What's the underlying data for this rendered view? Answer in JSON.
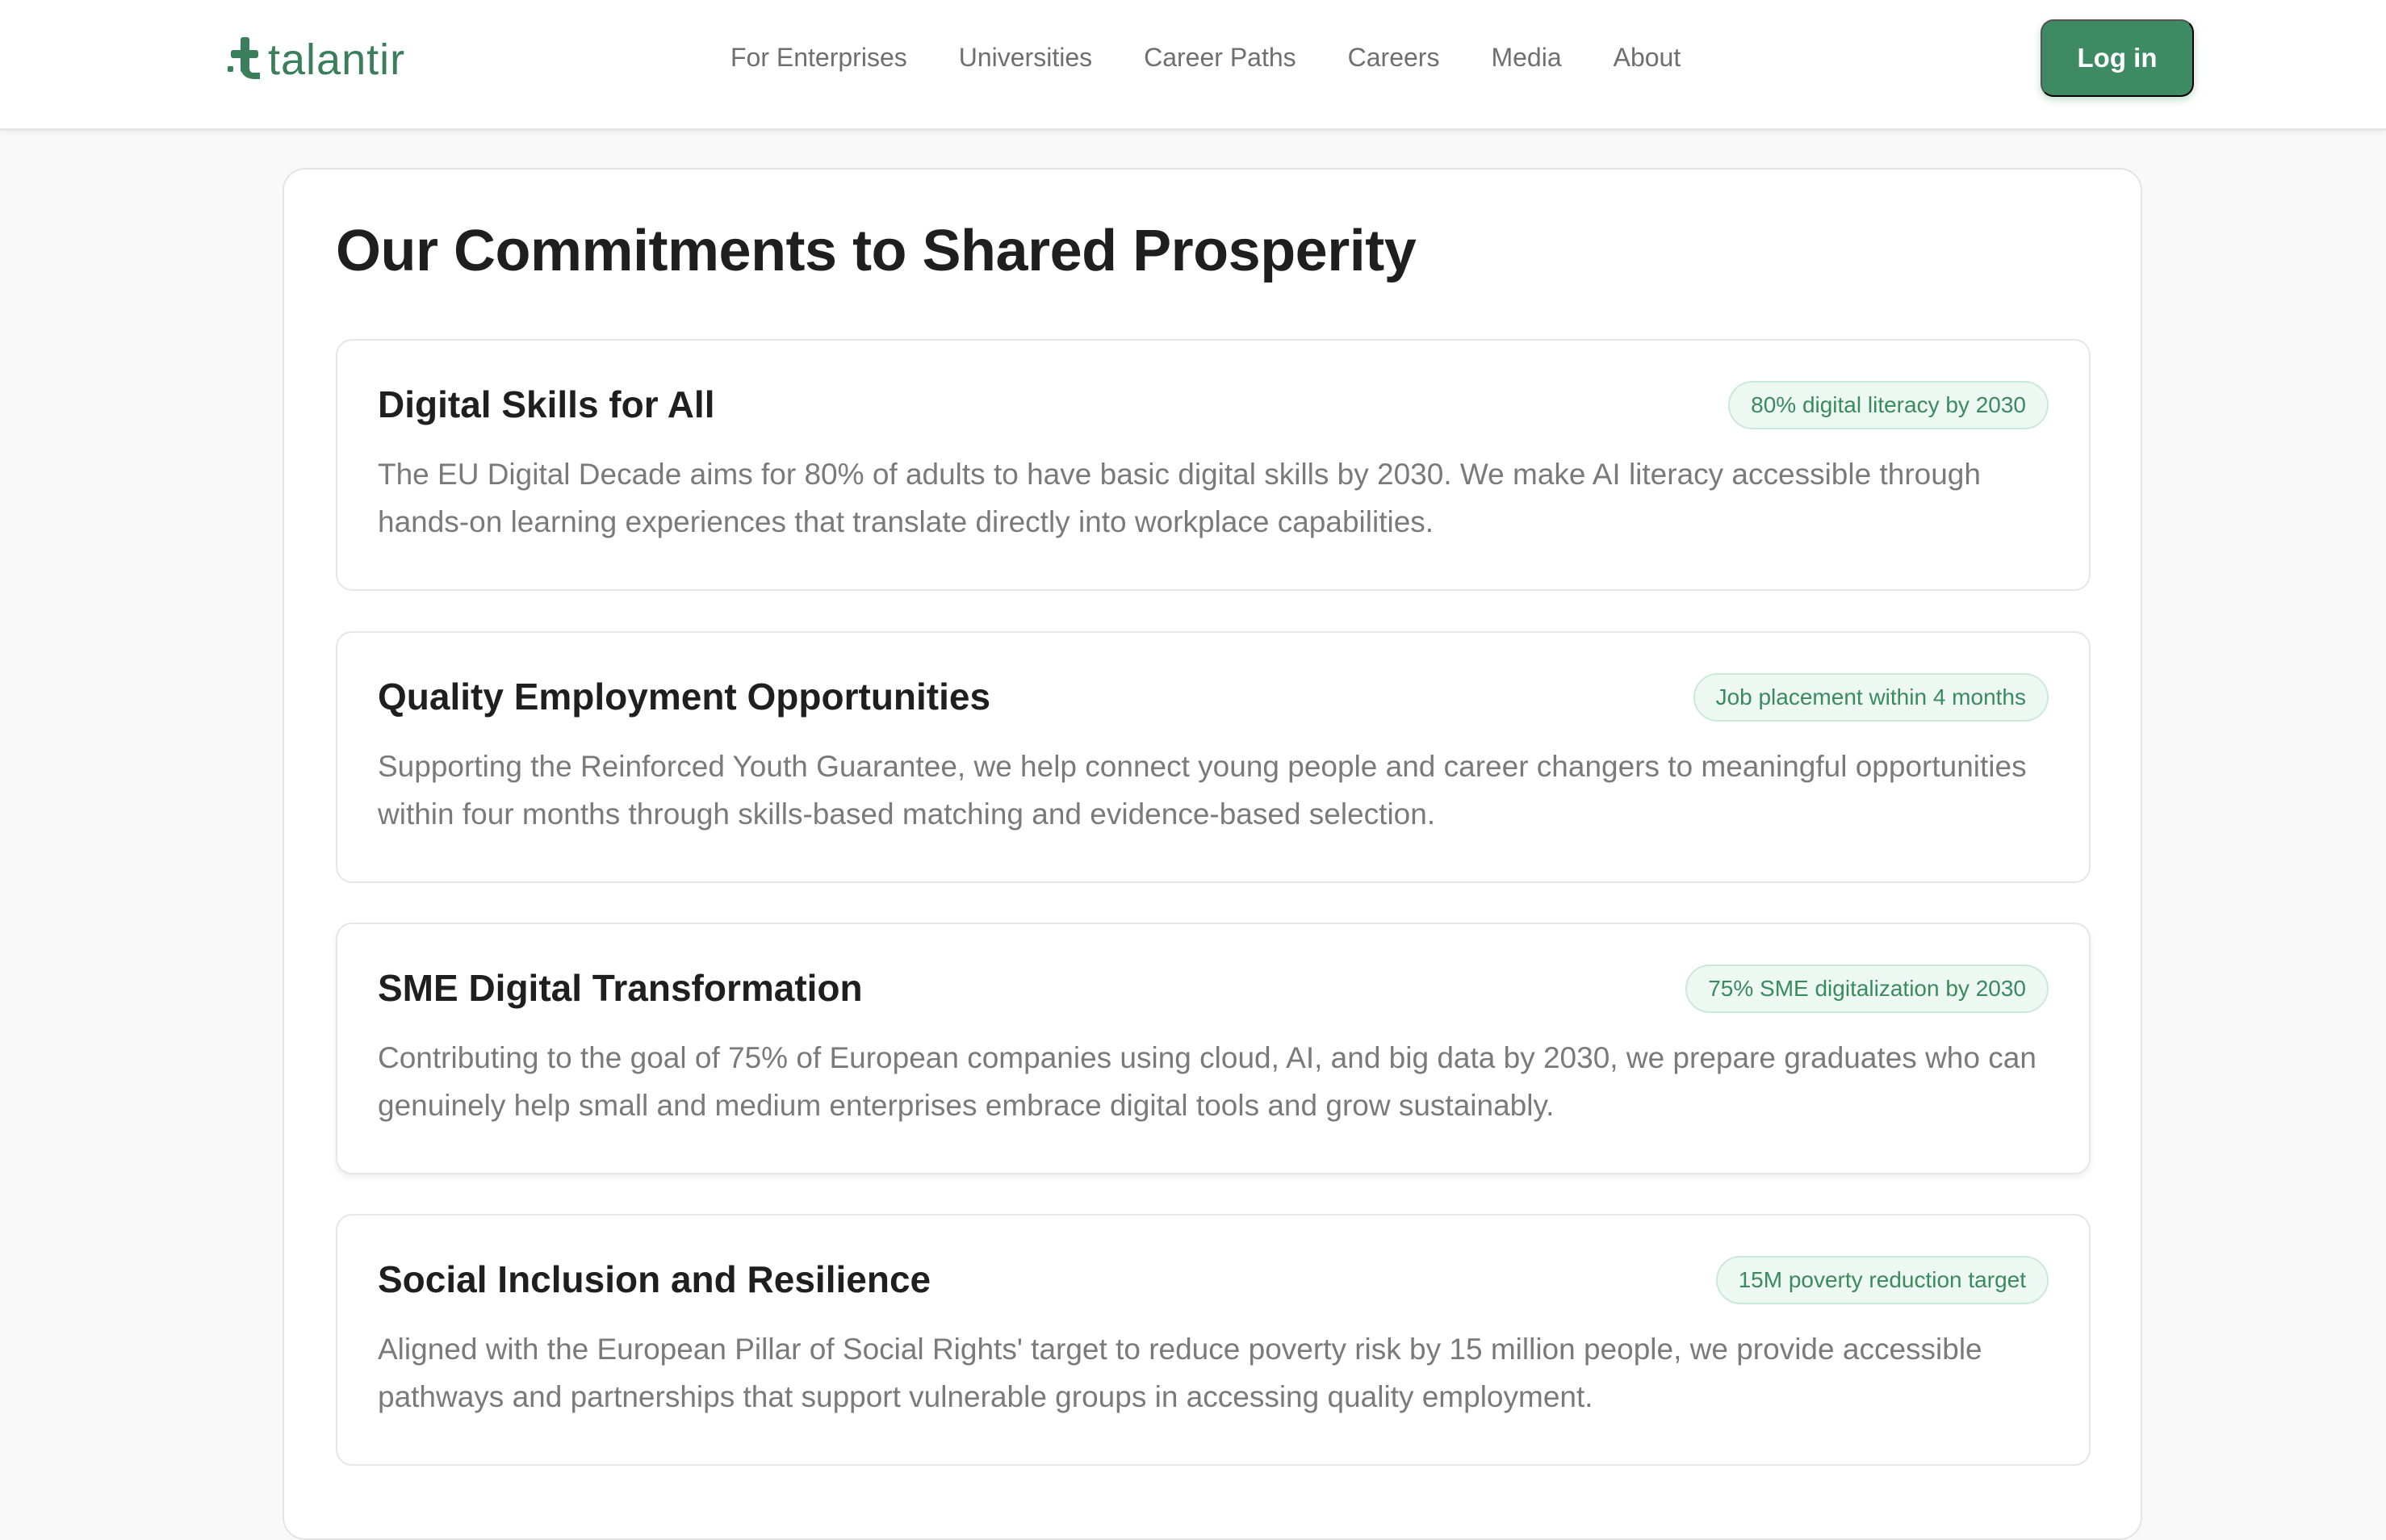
{
  "brand": {
    "name": "talantir",
    "color": "#3a7e5b"
  },
  "nav": {
    "items": [
      {
        "label": "For Enterprises"
      },
      {
        "label": "Universities"
      },
      {
        "label": "Career Paths"
      },
      {
        "label": "Careers"
      },
      {
        "label": "Media"
      },
      {
        "label": "About"
      }
    ],
    "login_label": "Log in"
  },
  "main": {
    "title": "Our Commitments to Shared Prosperity",
    "cards": [
      {
        "title": "Digital Skills for All",
        "badge": "80% digital literacy by 2030",
        "text": "The EU Digital Decade aims for 80% of adults to have basic digital skills by 2030. We make AI literacy accessible through hands-on learning experiences that translate directly into workplace capabilities."
      },
      {
        "title": "Quality Employment Opportunities",
        "badge": "Job placement within 4 months",
        "text": "Supporting the Reinforced Youth Guarantee, we help connect young people and career changers to meaningful opportunities within four months through skills-based matching and evidence-based selection."
      },
      {
        "title": "SME Digital Transformation",
        "badge": "75% SME digitalization by 2030",
        "text": "Contributing to the goal of 75% of European companies using cloud, AI, and big data by 2030, we prepare graduates who can genuinely help small and medium enterprises embrace digital tools and grow sustainably."
      },
      {
        "title": "Social Inclusion and Resilience",
        "badge": "15M poverty reduction target",
        "text": "Aligned with the European Pillar of Social Rights' target to reduce poverty risk by 15 million people, we provide accessible pathways and partnerships that support vulnerable groups in accessing quality employment."
      }
    ]
  },
  "colors": {
    "accent": "#3e8a63",
    "badge_bg": "#eef8f2",
    "badge_text": "#3a8a60",
    "body_text": "#7a7a7a",
    "heading": "#1f1f1f"
  }
}
